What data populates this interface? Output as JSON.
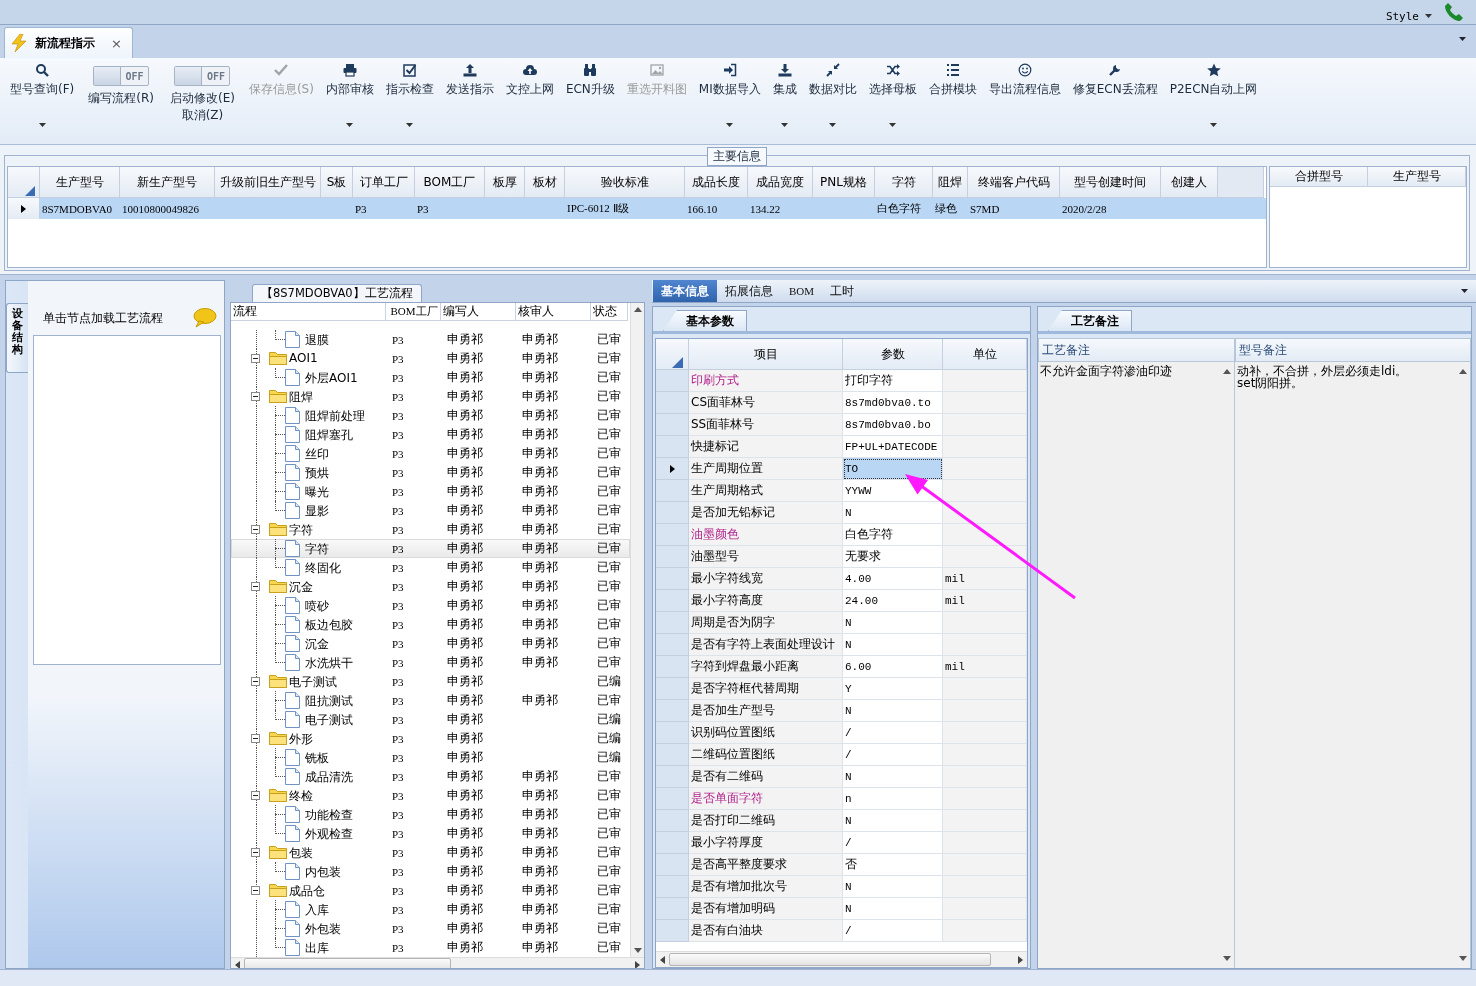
{
  "top_bar": {
    "style_menu": "Style"
  },
  "document_tab": {
    "title": "新流程指示",
    "close": "×"
  },
  "ribbon": [
    {
      "kind": "button",
      "label": "型号查询(F)",
      "dropdown": true,
      "disabled": false
    },
    {
      "kind": "toggle",
      "switch_text": "OFF",
      "on": false,
      "label": "编写流程(R)"
    },
    {
      "kind": "toggle",
      "switch_text": "OFF",
      "on": false,
      "label": "启动修改(E)",
      "label2": "取消(Z)"
    },
    {
      "kind": "button",
      "label": "保存信息(S)",
      "dropdown": false,
      "disabled": true
    },
    {
      "kind": "button",
      "label": "内部审核",
      "dropdown": true,
      "disabled": false
    },
    {
      "kind": "button",
      "label": "指示检查",
      "dropdown": true,
      "disabled": false
    },
    {
      "kind": "button",
      "label": "发送指示",
      "dropdown": false,
      "disabled": false
    },
    {
      "kind": "button",
      "label": "文控上网",
      "dropdown": false,
      "disabled": false
    },
    {
      "kind": "button",
      "label": "ECN升级",
      "dropdown": false,
      "disabled": false
    },
    {
      "kind": "button",
      "label": "重选开料图",
      "dropdown": false,
      "disabled": true
    },
    {
      "kind": "button",
      "label": "MI数据导入",
      "dropdown": true,
      "disabled": false
    },
    {
      "kind": "button",
      "label": "集成",
      "dropdown": true,
      "disabled": false
    },
    {
      "kind": "button",
      "label": "数据对比",
      "dropdown": true,
      "disabled": false
    },
    {
      "kind": "button",
      "label": "选择母板",
      "dropdown": true,
      "disabled": false
    },
    {
      "kind": "button",
      "label": "合拼模块",
      "dropdown": false,
      "disabled": false
    },
    {
      "kind": "button",
      "label": "导出流程信息",
      "dropdown": false,
      "disabled": false
    },
    {
      "kind": "button",
      "label": "修复ECN丢流程",
      "dropdown": false,
      "disabled": false
    },
    {
      "kind": "button",
      "label": "P2ECN自动上网",
      "dropdown": true,
      "disabled": false
    }
  ],
  "main_info": {
    "title": "主要信息",
    "table": {
      "columns": [
        "生产型号",
        "新生产型号",
        "升级前旧生产型号",
        "S板",
        "订单工厂",
        "BOM工厂",
        "板厚",
        "板材",
        "验收标准",
        "成品长度",
        "成品宽度",
        "PNL规格",
        "字符",
        "阻焊",
        "终端客户代码",
        "型号创建时间",
        "创建人"
      ],
      "rows": [
        {
          "selected": true,
          "cells": [
            "8S7MDOBVA0",
            "10010800049826",
            null,
            null,
            "P3",
            "P3",
            null,
            null,
            "IPC-6012 Ⅱ级",
            "166.10",
            "134.22",
            null,
            "白色字符",
            "绿色",
            "S7MD",
            "2020/2/28",
            null
          ]
        }
      ]
    },
    "merge_table": {
      "columns": [
        "合拼型号",
        "生产型号"
      ]
    }
  },
  "equipment_panel": {
    "tab": "设备结构",
    "hint": "单击节点加载工艺流程"
  },
  "process_tree": {
    "title": "【8S7MDOBVA0】工艺流程",
    "columns": [
      "流程",
      "BOM工厂",
      "编写人",
      "核审人",
      "状态"
    ],
    "nodes": [
      {
        "kind": "file",
        "label": "退膜",
        "bom": "P3",
        "writer": "申勇祁",
        "reviewer": "申勇祁",
        "status": "已审",
        "selected": false
      },
      {
        "kind": "folder",
        "label": "AOI1",
        "bom": "P3",
        "writer": "申勇祁",
        "reviewer": "申勇祁",
        "status": "已审",
        "selected": false,
        "expanded": true,
        "children": [
          {
            "kind": "file",
            "label": "外层AOI1",
            "bom": "P3",
            "writer": "申勇祁",
            "reviewer": "申勇祁",
            "status": "已审",
            "selected": false
          }
        ]
      },
      {
        "kind": "folder",
        "label": "阻焊",
        "bom": "P3",
        "writer": "申勇祁",
        "reviewer": "申勇祁",
        "status": "已审",
        "selected": false,
        "expanded": true,
        "children": [
          {
            "kind": "file",
            "label": "阻焊前处理",
            "bom": "P3",
            "writer": "申勇祁",
            "reviewer": "申勇祁",
            "status": "已审",
            "selected": false
          },
          {
            "kind": "file",
            "label": "阻焊塞孔",
            "bom": "P3",
            "writer": "申勇祁",
            "reviewer": "申勇祁",
            "status": "已审",
            "selected": false
          },
          {
            "kind": "file",
            "label": "丝印",
            "bom": "P3",
            "writer": "申勇祁",
            "reviewer": "申勇祁",
            "status": "已审",
            "selected": false
          },
          {
            "kind": "file",
            "label": "预烘",
            "bom": "P3",
            "writer": "申勇祁",
            "reviewer": "申勇祁",
            "status": "已审",
            "selected": false
          },
          {
            "kind": "file",
            "label": "曝光",
            "bom": "P3",
            "writer": "申勇祁",
            "reviewer": "申勇祁",
            "status": "已审",
            "selected": false
          },
          {
            "kind": "file",
            "label": "显影",
            "bom": "P3",
            "writer": "申勇祁",
            "reviewer": "申勇祁",
            "status": "已审",
            "selected": false
          }
        ]
      },
      {
        "kind": "folder",
        "label": "字符",
        "bom": "P3",
        "writer": "申勇祁",
        "reviewer": "申勇祁",
        "status": "已审",
        "selected": false,
        "expanded": true,
        "children": [
          {
            "kind": "file",
            "label": "字符",
            "bom": "P3",
            "writer": "申勇祁",
            "reviewer": "申勇祁",
            "status": "已审",
            "selected": true
          },
          {
            "kind": "file",
            "label": "终固化",
            "bom": "P3",
            "writer": "申勇祁",
            "reviewer": "申勇祁",
            "status": "已审",
            "selected": false
          }
        ]
      },
      {
        "kind": "folder",
        "label": "沉金",
        "bom": "P3",
        "writer": "申勇祁",
        "reviewer": "申勇祁",
        "status": "已审",
        "selected": false,
        "expanded": true,
        "children": [
          {
            "kind": "file",
            "label": "喷砂",
            "bom": "P3",
            "writer": "申勇祁",
            "reviewer": "申勇祁",
            "status": "已审",
            "selected": false
          },
          {
            "kind": "file",
            "label": "板边包胶",
            "bom": "P3",
            "writer": "申勇祁",
            "reviewer": "申勇祁",
            "status": "已审",
            "selected": false
          },
          {
            "kind": "file",
            "label": "沉金",
            "bom": "P3",
            "writer": "申勇祁",
            "reviewer": "申勇祁",
            "status": "已审",
            "selected": false
          },
          {
            "kind": "file",
            "label": "水洗烘干",
            "bom": "P3",
            "writer": "申勇祁",
            "reviewer": "申勇祁",
            "status": "已审",
            "selected": false
          }
        ]
      },
      {
        "kind": "folder",
        "label": "电子测试",
        "bom": "P3",
        "writer": "申勇祁",
        "status": "已编",
        "selected": false,
        "expanded": true,
        "children": [
          {
            "kind": "file",
            "label": "阻抗测试",
            "bom": "P3",
            "writer": "申勇祁",
            "reviewer": "申勇祁",
            "status": "已审",
            "selected": false
          },
          {
            "kind": "file",
            "label": "电子测试",
            "bom": "P3",
            "writer": "申勇祁",
            "status": "已编",
            "selected": false
          }
        ]
      },
      {
        "kind": "folder",
        "label": "外形",
        "bom": "P3",
        "writer": "申勇祁",
        "status": "已编",
        "selected": false,
        "expanded": true,
        "children": [
          {
            "kind": "file",
            "label": "铣板",
            "bom": "P3",
            "writer": "申勇祁",
            "status": "已编",
            "selected": false
          },
          {
            "kind": "file",
            "label": "成品清洗",
            "bom": "P3",
            "writer": "申勇祁",
            "reviewer": "申勇祁",
            "status": "已审",
            "selected": false
          }
        ]
      },
      {
        "kind": "folder",
        "label": "终检",
        "bom": "P3",
        "writer": "申勇祁",
        "reviewer": "申勇祁",
        "status": "已审",
        "selected": false,
        "expanded": true,
        "children": [
          {
            "kind": "file",
            "label": "功能检查",
            "bom": "P3",
            "writer": "申勇祁",
            "reviewer": "申勇祁",
            "status": "已审",
            "selected": false
          },
          {
            "kind": "file",
            "label": "外观检查",
            "bom": "P3",
            "writer": "申勇祁",
            "reviewer": "申勇祁",
            "status": "已审",
            "selected": false
          }
        ]
      },
      {
        "kind": "folder",
        "label": "包装",
        "bom": "P3",
        "writer": "申勇祁",
        "reviewer": "申勇祁",
        "status": "已审",
        "selected": false,
        "expanded": true,
        "children": [
          {
            "kind": "file",
            "label": "内包装",
            "bom": "P3",
            "writer": "申勇祁",
            "reviewer": "申勇祁",
            "status": "已审",
            "selected": false
          }
        ]
      },
      {
        "kind": "folder",
        "label": "成品仓",
        "bom": "P3",
        "writer": "申勇祁",
        "reviewer": "申勇祁",
        "status": "已审",
        "selected": false,
        "expanded": true,
        "children": [
          {
            "kind": "file",
            "label": "入库",
            "bom": "P3",
            "writer": "申勇祁",
            "reviewer": "申勇祁",
            "status": "已审",
            "selected": false
          },
          {
            "kind": "file",
            "label": "外包装",
            "bom": "P3",
            "writer": "申勇祁",
            "reviewer": "申勇祁",
            "status": "已审",
            "selected": false
          },
          {
            "kind": "file",
            "label": "出库",
            "bom": "P3",
            "writer": "申勇祁",
            "reviewer": "申勇祁",
            "status": "已审",
            "selected": false
          }
        ]
      }
    ]
  },
  "detail_tabs": [
    {
      "label": "基本信息",
      "selected": true
    },
    {
      "label": "拓展信息",
      "selected": false
    },
    {
      "label": "BOM",
      "selected": false
    },
    {
      "label": "工时",
      "selected": false
    }
  ],
  "params": {
    "tab": "基本参数",
    "columns": [
      "项目",
      "参数",
      "单位"
    ],
    "rows": [
      {
        "item": "印刷方式",
        "value": "打印字符",
        "emphasis": true,
        "selected": false
      },
      {
        "item": "CS面菲林号",
        "value": "8s7md0bva0.to",
        "emphasis": false,
        "selected": false
      },
      {
        "item": "SS面菲林号",
        "value": "8s7md0bva0.bo",
        "emphasis": false,
        "selected": false
      },
      {
        "item": "快捷标记",
        "value": "FP+UL+DATECODE",
        "emphasis": false,
        "selected": false
      },
      {
        "item": "生产周期位置",
        "value": "TO",
        "emphasis": false,
        "selected": true
      },
      {
        "item": "生产周期格式",
        "value": "YYWW",
        "emphasis": false,
        "selected": false
      },
      {
        "item": "是否加无铅标记",
        "value": "N",
        "emphasis": false,
        "selected": false
      },
      {
        "item": "油墨颜色",
        "value": "白色字符",
        "emphasis": true,
        "selected": false
      },
      {
        "item": "油墨型号",
        "value": "无要求",
        "emphasis": false,
        "selected": false
      },
      {
        "item": "最小字符线宽",
        "value": "4.00",
        "unit": "mil",
        "emphasis": false,
        "selected": false
      },
      {
        "item": "最小字符高度",
        "value": "24.00",
        "unit": "mil",
        "emphasis": false,
        "selected": false
      },
      {
        "item": "周期是否为阴字",
        "value": "N",
        "emphasis": false,
        "selected": false
      },
      {
        "item": "是否有字符上表面处理设计",
        "value": "N",
        "emphasis": false,
        "selected": false
      },
      {
        "item": "字符到焊盘最小距离",
        "value": "6.00",
        "unit": "mil",
        "emphasis": false,
        "selected": false
      },
      {
        "item": "是否字符框代替周期",
        "value": "Y",
        "emphasis": false,
        "selected": false
      },
      {
        "item": "是否加生产型号",
        "value": "N",
        "emphasis": false,
        "selected": false
      },
      {
        "item": "识别码位置图纸",
        "value": "/",
        "emphasis": false,
        "selected": false
      },
      {
        "item": "二维码位置图纸",
        "value": "/",
        "emphasis": false,
        "selected": false
      },
      {
        "item": "是否有二维码",
        "value": "N",
        "emphasis": false,
        "selected": false
      },
      {
        "item": "是否单面字符",
        "value": "n",
        "emphasis": true,
        "selected": false
      },
      {
        "item": "是否打印二维码",
        "value": "N",
        "emphasis": false,
        "selected": false
      },
      {
        "item": "最小字符厚度",
        "value": "/",
        "emphasis": false,
        "selected": false
      },
      {
        "item": "是否高平整度要求",
        "value": "否",
        "emphasis": false,
        "selected": false
      },
      {
        "item": "是否有增加批次号",
        "value": "N",
        "emphasis": false,
        "selected": false
      },
      {
        "item": "是否有增加明码",
        "value": "N",
        "emphasis": false,
        "selected": false
      },
      {
        "item": "是否有白油块",
        "value": "/",
        "emphasis": false,
        "selected": false
      }
    ]
  },
  "remarks": {
    "tab": "工艺备注",
    "columns": [
      "工艺备注",
      "型号备注"
    ],
    "values": [
      "不允许金面字符渗油印迹",
      "动补，不合拼，外层必须走ldi。\nset阴阳拼。"
    ]
  }
}
